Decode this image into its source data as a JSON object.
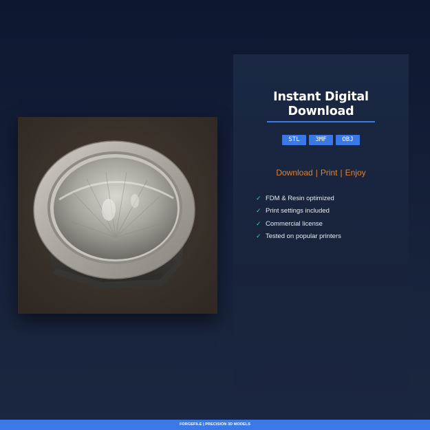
{
  "product": {
    "photo_alt": "3D printed hemispherical bowl model",
    "title_line1": "Instant Digital",
    "title_line2": "Download",
    "formats": [
      "STL",
      "3MF",
      "OBJ"
    ],
    "tagline": [
      "Download",
      "Print",
      "Enjoy"
    ],
    "tagline_separator": "|",
    "features": [
      "FDM & Resin optimized",
      "Print settings included",
      "Commercial license",
      "Tested on popular printers"
    ],
    "check_icon": "check-icon"
  },
  "footer": {
    "text": "FORGEFILE | PRECISION 3D MODELS"
  },
  "colors": {
    "accent_blue": "#3b79e7",
    "tagline_orange": "#e0832b",
    "check_teal": "#3fd1b3",
    "background": "#121c33"
  }
}
